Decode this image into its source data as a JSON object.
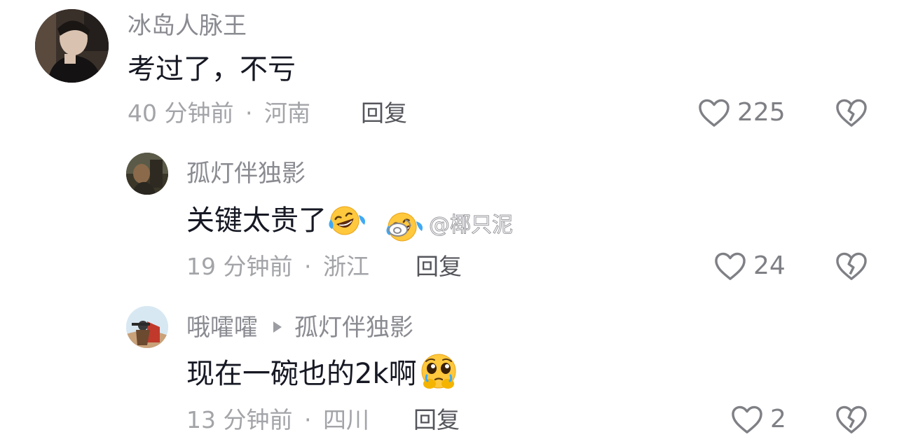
{
  "comments": [
    {
      "username": "冰岛人脉王",
      "text": "考过了，不亏",
      "time": "40 分钟前",
      "location": "河南",
      "reply_label": "回复",
      "likes": "225"
    },
    {
      "username": "孤灯伴独影",
      "text": "关键太贵了",
      "time": "19 分钟前",
      "location": "浙江",
      "reply_label": "回复",
      "likes": "24"
    },
    {
      "username": "哦嚯嚯",
      "reply_to": "孤灯伴独影",
      "text": "现在一碗也的2k啊",
      "time": "13 分钟前",
      "location": "四川",
      "reply_label": "回复",
      "likes": "2"
    }
  ],
  "separator": "·",
  "watermark": "@椰只泥",
  "icons": {
    "like": "heart-outline-icon",
    "dislike": "broken-heart-icon",
    "emoji_laugh": "laughing-crying-emoji",
    "emoji_plead": "pleading-emoji",
    "watermark_logo": "weibo-logo"
  }
}
